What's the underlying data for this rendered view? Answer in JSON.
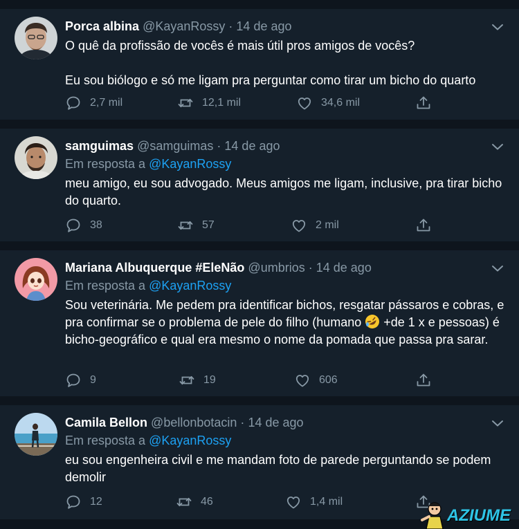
{
  "tweets": [
    {
      "name": "Porca albina",
      "handle": "@KayanRossy",
      "separator": "·",
      "date": "14 de ago",
      "text": "O quê da profissão de vocês é mais útil pros amigos de vocês?\n\nEu sou biólogo e só me ligam pra perguntar como tirar um bicho do quarto",
      "replies": "2,7 mil",
      "retweets": "12,1 mil",
      "likes": "34,6 mil"
    },
    {
      "name": "samguimas",
      "handle": "@samguimas",
      "separator": "·",
      "date": "14 de ago",
      "reply_prefix": "Em resposta a",
      "reply_mention": "@KayanRossy",
      "text": "meu amigo, eu sou advogado. Meus amigos me ligam, inclusive, pra tirar bicho do quarto.",
      "replies": "38",
      "retweets": "57",
      "likes": "2 mil"
    },
    {
      "name": "Mariana Albuquerque #EleNão",
      "handle": "@umbrios",
      "separator": "·",
      "date": "14 de ago",
      "reply_prefix": "Em resposta a",
      "reply_mention": "@KayanRossy",
      "text_before_emoji": "Sou veterinária. Me pedem pra identificar bichos, resgatar pássaros e cobras, e pra confirmar se o problema de pele do filho (humano ",
      "emoji": "rolling-on-floor-laughing-emoji",
      "text_after_emoji": " +de 1 x e pessoas) é bicho-geográfico e qual era mesmo o nome da pomada que passa pra sarar.",
      "replies": "9",
      "retweets": "19",
      "likes": "606"
    },
    {
      "name": "Camila Bellon",
      "handle": "@bellonbotacin",
      "separator": "·",
      "date": "14 de ago",
      "reply_prefix": "Em resposta a",
      "reply_mention": "@KayanRossy",
      "text": "eu sou engenheira civil e me mandam foto de parede perguntando se podem demolir",
      "replies": "12",
      "retweets": "46",
      "likes": "1,4 mil"
    }
  ],
  "icons": {
    "reply": "speech-bubble-icon",
    "retweet": "retweet-arrows-icon",
    "like": "heart-outline-icon",
    "share": "share-upload-icon",
    "more": "chevron-down-icon"
  },
  "colors": {
    "background": "#15202b",
    "separator": "#0e151d",
    "text": "#ffffff",
    "muted": "#8899a6",
    "accent": "#1da1f2"
  },
  "watermark": {
    "text": "AZIUME"
  }
}
